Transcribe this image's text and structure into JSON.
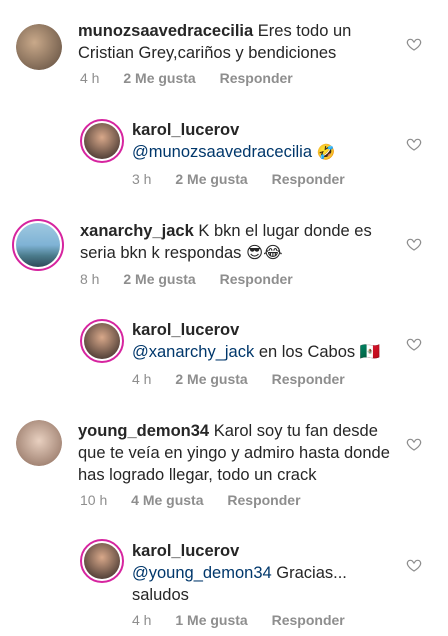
{
  "comments": [
    {
      "user": "munozsaavedracecilia",
      "text_parts": [
        "Eres todo un Cristian Grey,cariños y bendiciones"
      ],
      "time": "4 h",
      "likes": "2 Me gusta",
      "reply": "Responder",
      "avatar_colors": [
        "#c9a98a",
        "#5c4a3c"
      ]
    },
    {
      "user": "karol_lucerov",
      "mention": "@munozsaavedracecilia",
      "text_after": "🤣",
      "time": "3 h",
      "likes": "2 Me gusta",
      "reply": "Responder",
      "avatar_colors": [
        "#d8a88a",
        "#2b2220"
      ]
    },
    {
      "user": "xanarchy_jack",
      "text": "K bkn el lugar donde es seria bkn k respondas 😎😂",
      "time": "8 h",
      "likes": "2 Me gusta",
      "reply": "Responder",
      "avatar_colors": [
        "#7fb3d5",
        "#2e4a5a"
      ]
    },
    {
      "user": "karol_lucerov",
      "mention": "@xanarchy_jack",
      "text_after": "en los Cabos 🇲🇽",
      "time": "4 h",
      "likes": "2 Me gusta",
      "reply": "Responder",
      "avatar_colors": [
        "#d8a88a",
        "#2b2220"
      ]
    },
    {
      "user": "young_demon34",
      "text": "Karol soy tu fan desde que te veía en yingo y admiro hasta donde has logrado llegar, todo un crack",
      "time": "10 h",
      "likes": "4 Me gusta",
      "reply": "Responder",
      "avatar_colors": [
        "#e8d0c0",
        "#8a6a5a"
      ]
    },
    {
      "user": "karol_lucerov",
      "mention": "@young_demon34",
      "text_after": "Gracias... saludos",
      "time": "4 h",
      "likes": "1 Me gusta",
      "reply": "Responder",
      "avatar_colors": [
        "#d8a88a",
        "#2b2220"
      ]
    }
  ],
  "icons": {
    "like": "heart-outline-icon"
  },
  "colors": {
    "story_ring": "#d6249f",
    "mention": "#00376b",
    "meta": "#8e8e8e"
  }
}
